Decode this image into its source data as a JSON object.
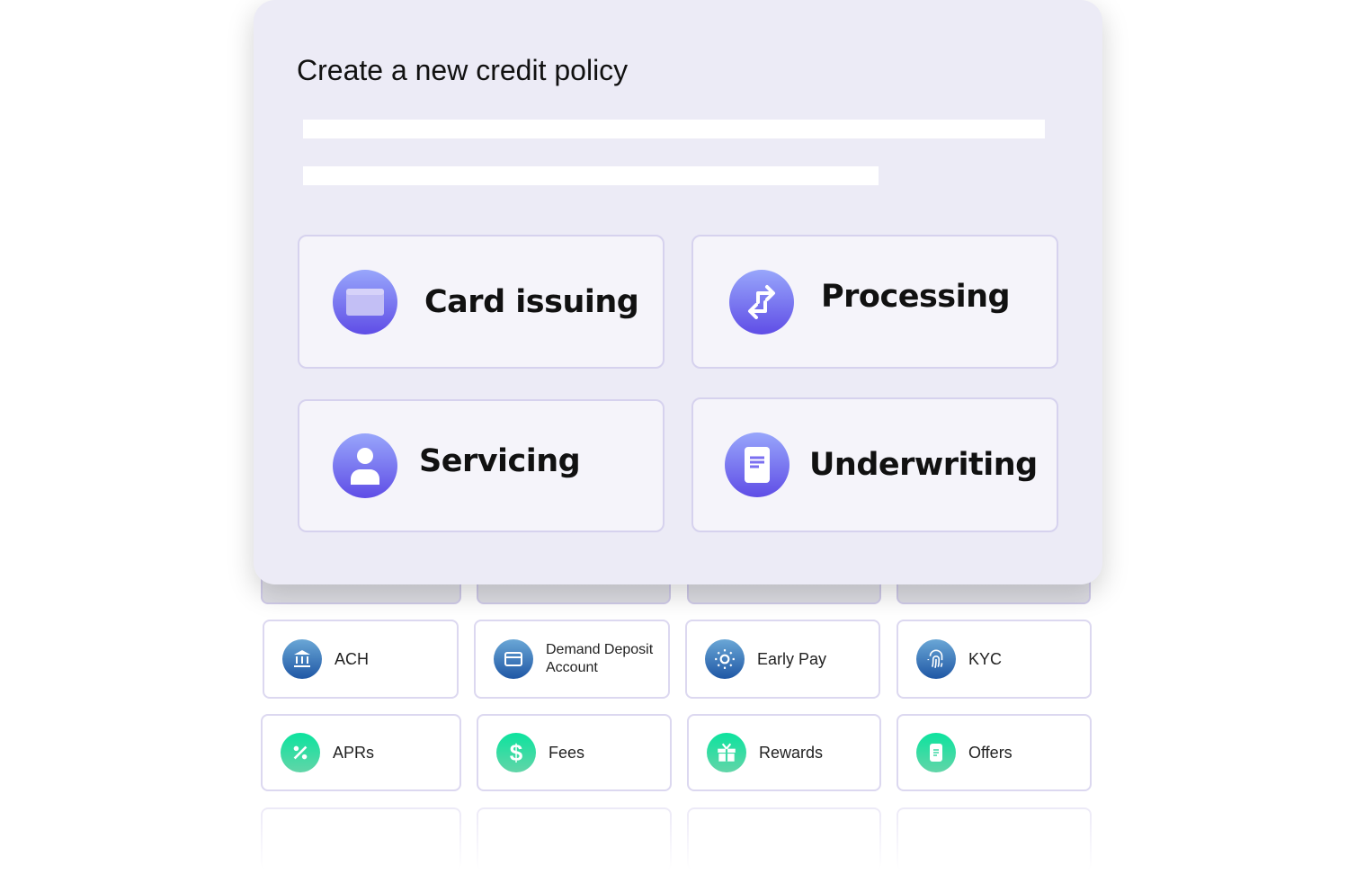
{
  "panel": {
    "title": "Create a new credit policy"
  },
  "categories": [
    {
      "label": "Card issuing",
      "icon": "credit-card-icon"
    },
    {
      "label": "Processing",
      "icon": "exchange-arrows-icon"
    },
    {
      "label": "Servicing",
      "icon": "user-icon"
    },
    {
      "label": "Underwriting",
      "icon": "document-icon"
    }
  ],
  "features": [
    {
      "label": "ACH",
      "icon": "bank-icon"
    },
    {
      "label": "Demand Deposit Account",
      "icon": "credit-card-icon"
    },
    {
      "label": "Early Pay",
      "icon": "sun-icon"
    },
    {
      "label": "KYC",
      "icon": "fingerprint-icon"
    },
    {
      "label": "APRs",
      "icon": "percent-icon"
    },
    {
      "label": "Fees",
      "icon": "dollar-icon"
    },
    {
      "label": "Rewards",
      "icon": "gift-icon"
    },
    {
      "label": "Offers",
      "icon": "document-icon"
    }
  ],
  "colors": {
    "accent": "#6a5ae8",
    "blue": "#1f57a5",
    "green": "#0ce39e"
  }
}
